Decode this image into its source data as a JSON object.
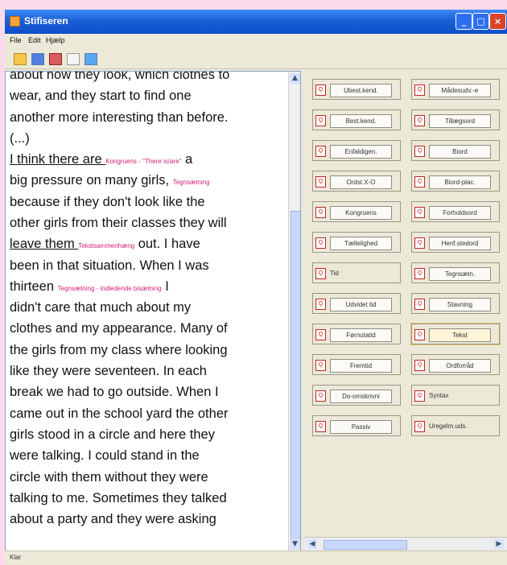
{
  "window": {
    "title": "Stifiseren",
    "buttons": {
      "minimize": "_",
      "maximize": "□",
      "close": "×"
    }
  },
  "menu": {
    "items": [
      "File",
      "Edit",
      "Hjælp"
    ]
  },
  "toolbar": {
    "icons": [
      "folder-open-icon",
      "save-icon",
      "edit-icon",
      "document-icon",
      "window-icon"
    ]
  },
  "editor": {
    "lines": [
      {
        "text": "about how they look, which clothes to",
        "note": ""
      },
      {
        "text": "wear, and they start to find one",
        "note": ""
      },
      {
        "text": "another more interesting than before.",
        "note": ""
      },
      {
        "text": "(...)",
        "note": ""
      },
      {
        "text": "I think there are ",
        "note": "Kongruens - \"There is/are\"",
        "tail": " a"
      },
      {
        "text": "big pressure on many girls,",
        "note": "Tegnsætning",
        "tail": ""
      },
      {
        "text": "because if they don't look like the",
        "note": ""
      },
      {
        "text": "other girls from their classes they will",
        "note": ""
      },
      {
        "text": "leave them ",
        "note": "Tekstsammenhæng",
        "tail": " out. I have"
      },
      {
        "text": "been in that situation. When I was",
        "note": ""
      },
      {
        "text": "thirteen ",
        "note": "Tegnsætning - indledende bisætning",
        "tail": " I"
      },
      {
        "text": "didn't care that much about my",
        "note": ""
      },
      {
        "text": "clothes and my appearance. Many of",
        "note": ""
      },
      {
        "text": "the girls from my class where looking",
        "note": ""
      },
      {
        "text": "like they were seventeen. In each",
        "note": ""
      },
      {
        "text": "break we had to go outside. When I",
        "note": ""
      },
      {
        "text": "came out in the school yard the other",
        "note": ""
      },
      {
        "text": "girls stood in a circle and here they",
        "note": ""
      },
      {
        "text": "were talking. I could stand in the",
        "note": ""
      },
      {
        "text": "circle with them without they were",
        "note": ""
      },
      {
        "text": "talking to me. Sometimes they talked",
        "note": ""
      },
      {
        "text": "about a party and they were asking",
        "note": ""
      }
    ]
  },
  "panel": {
    "buttons": [
      {
        "label": "Ubest.kend.",
        "style": "boxed"
      },
      {
        "label": "Mådesudv.-e",
        "style": "boxed"
      },
      {
        "label": "Best.kend.",
        "style": "boxed"
      },
      {
        "label": "Tillægsord",
        "style": "boxed"
      },
      {
        "label": "Enfaldigen.",
        "style": "boxed"
      },
      {
        "label": "Biord",
        "style": "boxed"
      },
      {
        "label": "Ordst.X-O",
        "style": "boxed"
      },
      {
        "label": "Biord-plac.",
        "style": "boxed"
      },
      {
        "label": "Kongruens",
        "style": "boxed"
      },
      {
        "label": "Forholdsord",
        "style": "boxed"
      },
      {
        "label": "Tællelighed",
        "style": "boxed"
      },
      {
        "label": "Henf.stedord",
        "style": "boxed"
      },
      {
        "label": "Tid",
        "style": "plain"
      },
      {
        "label": "Tegnsætn.",
        "style": "boxed"
      },
      {
        "label": "Udvidet tid",
        "style": "boxed"
      },
      {
        "label": "Stavning",
        "style": "boxed"
      },
      {
        "label": "Førnutatid",
        "style": "boxed"
      },
      {
        "label": "Tekst",
        "style": "selected"
      },
      {
        "label": "Fremtid",
        "style": "boxed"
      },
      {
        "label": "Ordforråd",
        "style": "boxed"
      },
      {
        "label": "Do-omskrivni",
        "style": "boxed"
      },
      {
        "label": "Syntax",
        "style": "plain"
      },
      {
        "label": "Passiv",
        "style": "boxed"
      },
      {
        "label": "Uregelm.uds.",
        "style": "plain"
      }
    ]
  },
  "status": {
    "text": "Klar"
  }
}
